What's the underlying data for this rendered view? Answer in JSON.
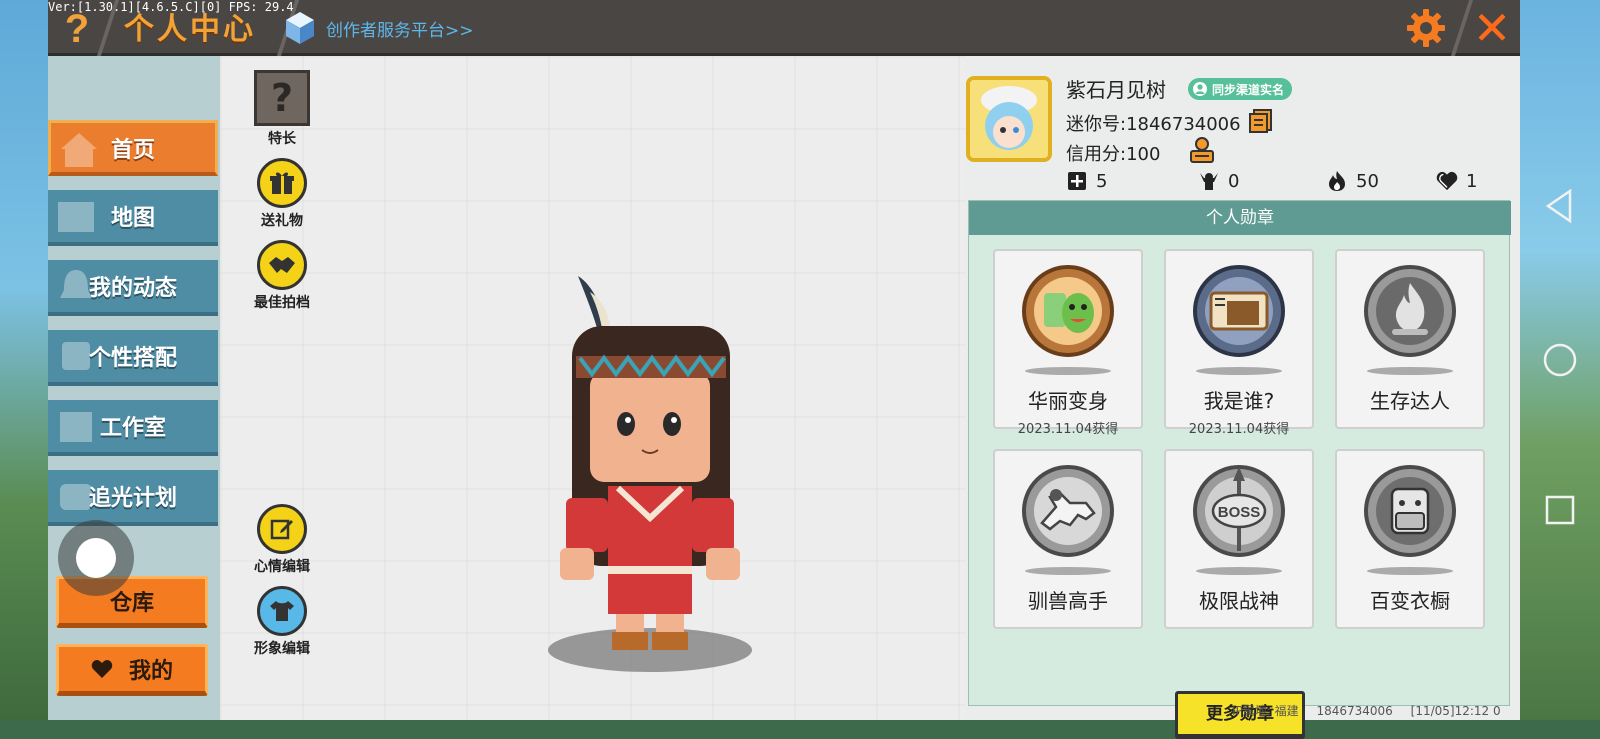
{
  "debug": {
    "fps_text": "Ver:[1.30.1][4.6.5.C][0] FPS: 29.4"
  },
  "header": {
    "help_icon_text": "?",
    "title": "个人中心",
    "platform_link": "创作者服务平台>>",
    "close_icon_text": "✕"
  },
  "sidebar": {
    "items": [
      {
        "label": "首页",
        "icon": "house-icon",
        "active": true
      },
      {
        "label": "地图",
        "icon": "map-icon",
        "active": false
      },
      {
        "label": "我的动态",
        "icon": "bell-icon",
        "active": false
      },
      {
        "label": "个性搭配",
        "icon": "character-icon",
        "active": false
      },
      {
        "label": "工作室",
        "icon": "studio-icon",
        "active": false
      },
      {
        "label": "追光计划",
        "icon": "lightchase-icon",
        "active": false
      }
    ],
    "warehouse_label": "仓库",
    "mine_label": "我的"
  },
  "tools": {
    "specialty": {
      "label": "特长",
      "icon_text": "?"
    },
    "send_gift": {
      "label": "送礼物"
    },
    "best_partner": {
      "label": "最佳拍档"
    },
    "mood_edit": {
      "label": "心情编辑"
    },
    "appearance_edit": {
      "label": "形象编辑"
    }
  },
  "profile": {
    "username": "紫石月见树",
    "verify_badge": "同步渠道实名",
    "mini_id": "迷你号:1846734006",
    "credit": "信用分:100",
    "stats": [
      {
        "icon": "plus-square-icon",
        "value": "5"
      },
      {
        "icon": "trophy-person-icon",
        "value": "0"
      },
      {
        "icon": "flame-icon",
        "value": "50"
      },
      {
        "icon": "heart-icon",
        "value": "1"
      }
    ]
  },
  "medals": {
    "header": "个人勋章",
    "items": [
      {
        "name": "华丽变身",
        "date": "2023.11.04获得",
        "unlocked": true,
        "icon": "dino-mask-medal-icon"
      },
      {
        "name": "我是谁?",
        "date": "2023.11.04获得",
        "unlocked": true,
        "icon": "id-card-medal-icon"
      },
      {
        "name": "生存达人",
        "date": "",
        "unlocked": false,
        "icon": "campfire-medal-icon"
      },
      {
        "name": "驯兽高手",
        "date": "",
        "unlocked": false,
        "icon": "horse-medal-icon"
      },
      {
        "name": "极限战神",
        "date": "",
        "unlocked": false,
        "icon": "boss-medal-icon"
      },
      {
        "name": "百变衣橱",
        "date": "",
        "unlocked": false,
        "icon": "wardrobe-medal-icon"
      }
    ],
    "more_button": "更多勋章"
  },
  "footer": {
    "ip_location": "IP属地: 福建",
    "uid": "1846734006",
    "datetime": "[11/05]12:12 0"
  },
  "colors": {
    "accent_orange": "#f47b1f",
    "title_orange": "#f3a237",
    "sidebar_blue": "#4f8da4",
    "medal_header": "#5f9b93",
    "yellow_button": "#f7e22a"
  }
}
